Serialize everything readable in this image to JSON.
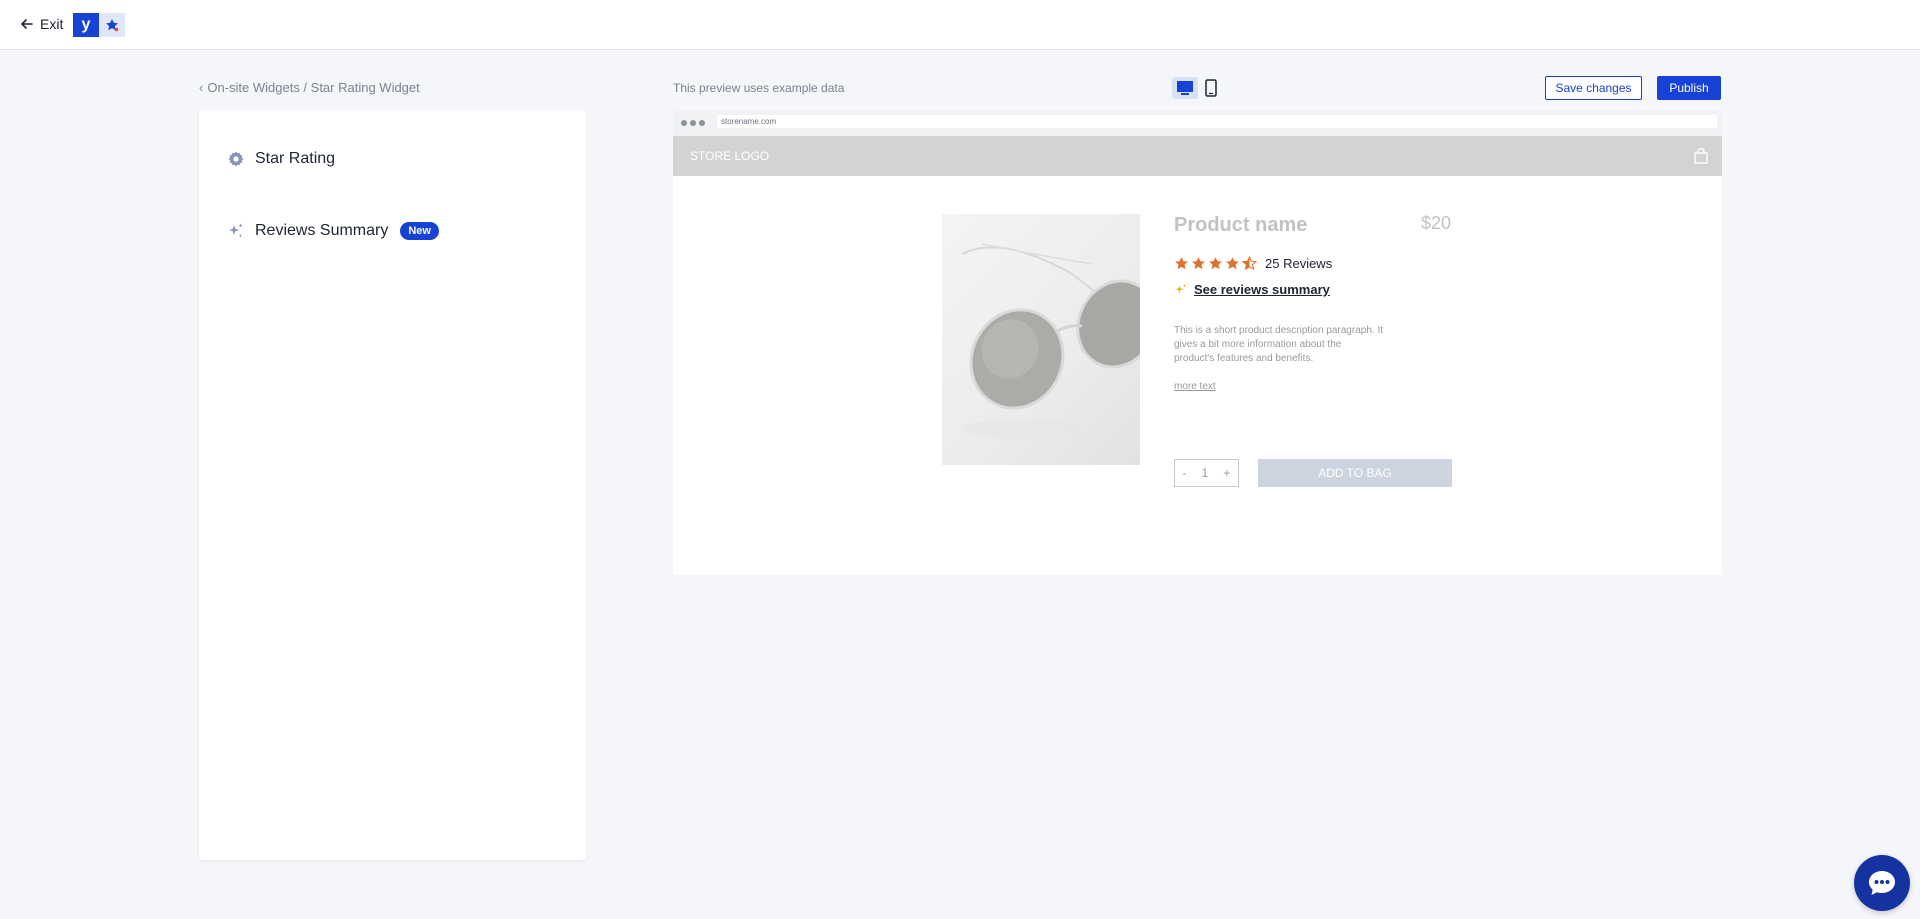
{
  "topbar": {
    "exit_label": "Exit",
    "app_letter": "y"
  },
  "breadcrumb": {
    "text": "On-site Widgets / Star Rating Widget"
  },
  "sidebar": {
    "items": [
      {
        "label": "Star Rating",
        "icon": "gear-icon"
      },
      {
        "label": "Reviews Summary",
        "icon": "sparkle-icon",
        "badge": "New"
      }
    ]
  },
  "preview_header": {
    "note": "This preview uses example data",
    "save_label": "Save changes",
    "publish_label": "Publish",
    "active_device": "desktop"
  },
  "preview": {
    "url": "storename.com",
    "store_logo": "STORE LOGO",
    "product": {
      "name": "Product name",
      "price": "$20",
      "rating": 4.5,
      "review_count_label": "25 Reviews",
      "summary_link": "See reviews summary",
      "description": "This is a short product description paragraph. It gives a bit more information about the product's features and benefits.",
      "more_text": "more text",
      "quantity": "1",
      "qty_minus": "-",
      "qty_plus": "+",
      "add_to_bag": "ADD TO BAG"
    }
  },
  "colors": {
    "accent": "#1742d6",
    "star": "#e0702a",
    "background": "#f4f6fa"
  }
}
